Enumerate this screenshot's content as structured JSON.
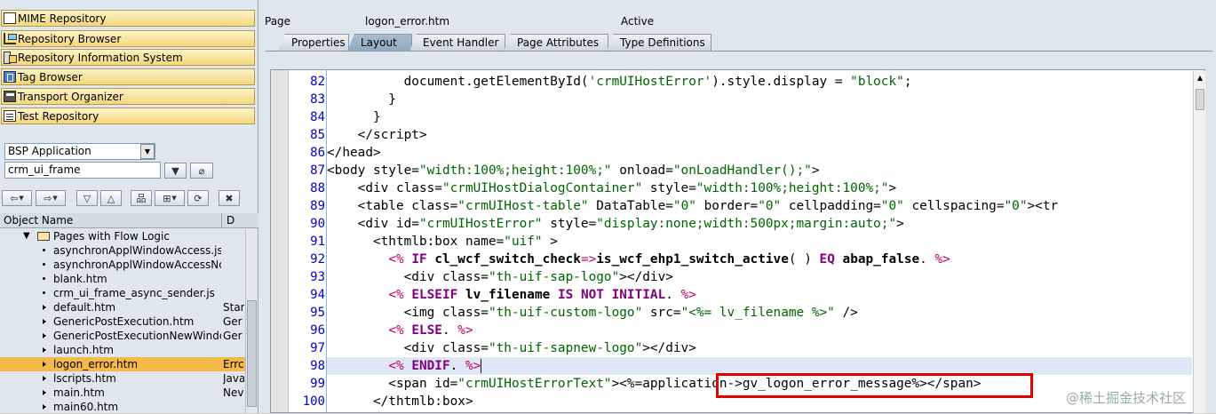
{
  "nav": {
    "mime": "MIME Repository",
    "repo_browser": "Repository Browser",
    "ris": "Repository Information System",
    "tag_browser": "Tag Browser",
    "transport": "Transport Organizer",
    "test_repo": "Test Repository"
  },
  "selector": {
    "type": "BSP Application",
    "name": "crm_ui_frame"
  },
  "tree": {
    "col_name": "Object Name",
    "col_desc": "D",
    "folder": "Pages with Flow Logic",
    "items": [
      {
        "name": "asynchronApplWindowAccess.js",
        "desc": ""
      },
      {
        "name": "asynchronApplWindowAccessNoSw",
        "desc": ""
      },
      {
        "name": "blank.htm",
        "desc": ""
      },
      {
        "name": "crm_ui_frame_async_sender.js",
        "desc": ""
      },
      {
        "name": "default.htm",
        "desc": "Star"
      },
      {
        "name": "GenericPostExecution.htm",
        "desc": "Ger"
      },
      {
        "name": "GenericPostExecutionNewWindow",
        "desc": "Ger"
      },
      {
        "name": "launch.htm",
        "desc": ""
      },
      {
        "name": "logon_error.htm",
        "desc": "Errc"
      },
      {
        "name": "lscripts.htm",
        "desc": "Java"
      },
      {
        "name": "main.htm",
        "desc": "Nev"
      },
      {
        "name": "main60.htm",
        "desc": ""
      }
    ]
  },
  "header": {
    "page_label": "Page",
    "page_name": "logon_error.htm",
    "status": "Active"
  },
  "tabs": [
    "Properties",
    "Layout",
    "Event Handler",
    "Page Attributes",
    "Type Definitions"
  ],
  "editor": {
    "line_numbers": [
      "82",
      "83",
      "84",
      "85",
      "86",
      "87",
      "88",
      "89",
      "90",
      "91",
      "92",
      "93",
      "94",
      "95",
      "96",
      "97",
      "98",
      "99",
      "100"
    ]
  },
  "watermark": "@稀土掘金技术社区"
}
